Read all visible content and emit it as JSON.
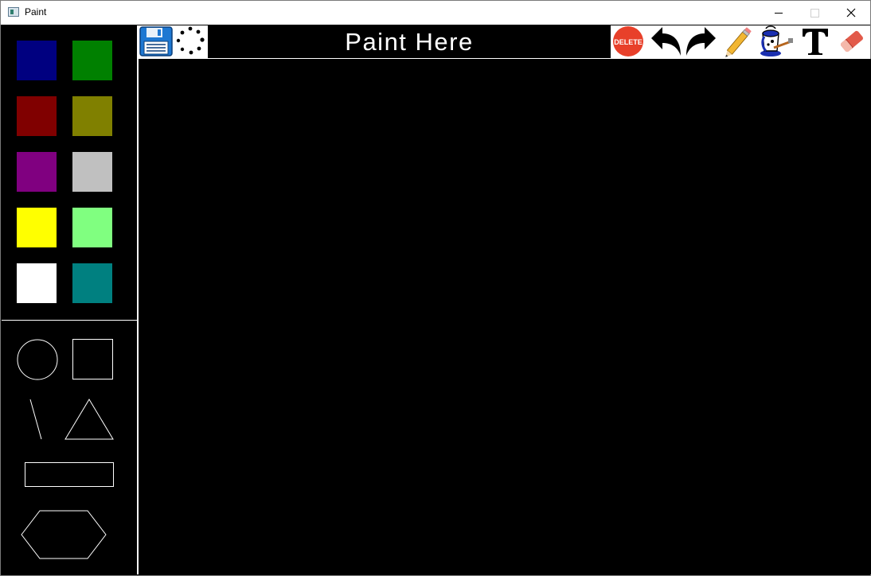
{
  "window": {
    "title": "Paint"
  },
  "banner": {
    "text": "Paint Here"
  },
  "toolbar": {
    "delete_label": "DELETE",
    "tools": [
      "save-icon",
      "spray-icon",
      "delete-icon",
      "undo-icon",
      "redo-icon",
      "pencil-icon",
      "paint-bucket-icon",
      "text-icon",
      "eraser-icon"
    ]
  },
  "palette": {
    "colors": [
      "#000080",
      "#008000",
      "#800000",
      "#808000",
      "#800080",
      "#c0c0c0",
      "#ffff00",
      "#80ff80",
      "#ffffff",
      "#008080"
    ]
  },
  "shapes": [
    "circle",
    "square",
    "line",
    "triangle",
    "rectangle",
    "hexagon"
  ],
  "theme": {
    "accent_delete": "#e8402a",
    "save_blue": "#1e78d2"
  }
}
